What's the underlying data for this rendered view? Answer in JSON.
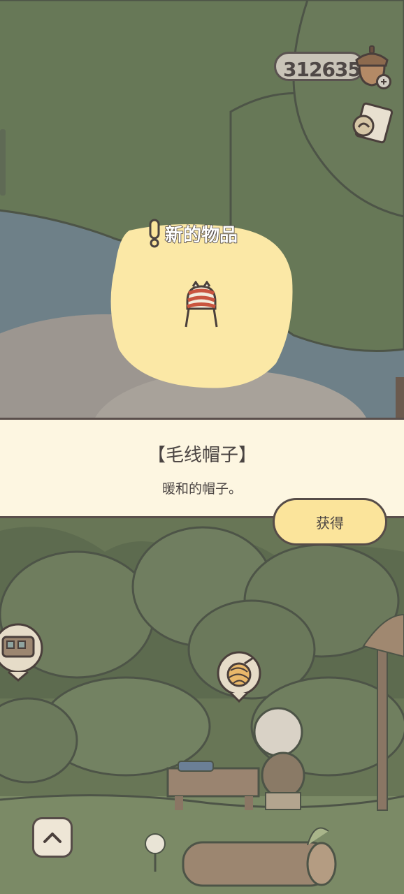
{
  "hud": {
    "acorn_count": "312635"
  },
  "popup": {
    "new_item_label": "新的物品",
    "item_name": "【毛线帽子】",
    "item_description": "暖和的帽子。",
    "obtain_button_label": "获得"
  },
  "icons": {
    "currency": "acorn-icon",
    "add": "plus-icon",
    "letter": "letter-icon",
    "alert": "exclamation-icon",
    "item": "knit-hat-icon",
    "train": "train-icon",
    "yarn": "yarn-ball-icon",
    "expand": "chevron-up-icon"
  },
  "colors": {
    "banner_bg": "#fdf6e1",
    "button_bg": "#fbe49b",
    "spotlight": "#fbe8a6",
    "outline": "#564c48"
  }
}
